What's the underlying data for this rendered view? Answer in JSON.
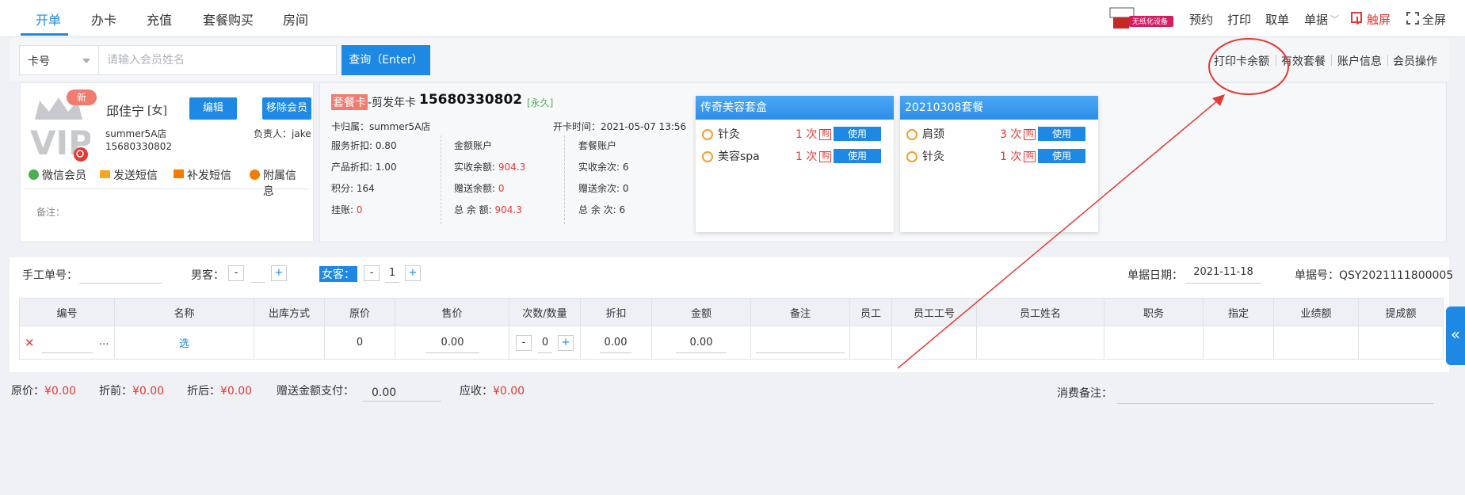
{
  "nav": {
    "tabs": [
      "开单",
      "办卡",
      "充值",
      "套餐购买",
      "房间"
    ],
    "device_badge": "无纸化设备",
    "right": [
      "预约",
      "打印",
      "取单",
      "单据",
      "触屏",
      "全屏"
    ]
  },
  "search": {
    "select_value": "卡号",
    "placeholder": "请输入会员姓名",
    "query_label": "查询（Enter）"
  },
  "account_links": [
    "打印卡余额",
    "有效套餐",
    "账户信息",
    "会员操作"
  ],
  "member": {
    "badge_new": "新",
    "avatar_text": "VIP",
    "name": "邱佳宁",
    "gender": "[女]",
    "store": "summer5A店",
    "phone": "15680330802",
    "edit_label": "编辑",
    "remove_label": "移除会员",
    "owner_label": "负责人：jake",
    "actions": [
      "微信会员",
      "发送短信",
      "补发短信",
      "附属信息"
    ],
    "remark_label": "备注："
  },
  "card": {
    "type_tag": "套餐卡",
    "type_suffix": "-剪发年卡",
    "number": "15680330802",
    "validity": "[永久]",
    "belong": "卡归属：summer5A店",
    "open_time": "开卡时间：2021-05-07 13:56",
    "col1": [
      {
        "label": "服务折扣: 0.80",
        "value": ""
      },
      {
        "label": "产品折扣: 1.00",
        "value": ""
      },
      {
        "label": "积分: 164",
        "value": ""
      },
      {
        "label": "挂账: ",
        "value": "0"
      }
    ],
    "col2_title": "金额账户",
    "col2": [
      {
        "label": "实收余额: ",
        "value": "904.3"
      },
      {
        "label": "赠送余额: ",
        "value": "0"
      },
      {
        "label": "总 余 额: ",
        "value": "904.3"
      }
    ],
    "col3_title": "套餐账户",
    "col3": [
      "实收余次: 6",
      "赠送余次: 0",
      "总 余 次: 6"
    ]
  },
  "packages": [
    {
      "title": "传奇美容套盒",
      "items": [
        {
          "name": "针灸",
          "count": "1 次",
          "buy": "购",
          "use": "使用",
          "icon": "service-icon"
        },
        {
          "name": "美容spa",
          "count": "1 次",
          "buy": "购",
          "use": "使用",
          "icon": "service-icon"
        }
      ]
    },
    {
      "title": "20210308套餐",
      "items": [
        {
          "name": "肩颈",
          "count": "3 次",
          "buy": "购",
          "use": "使用",
          "icon": "service-icon"
        },
        {
          "name": "针灸",
          "count": "1 次",
          "buy": "购",
          "use": "使用",
          "icon": "service-icon"
        }
      ]
    }
  ],
  "order": {
    "manual_no_label": "手工单号：",
    "male_label": "男客：",
    "male_value": "",
    "female_label": "女客：",
    "female_value": "1",
    "date_label": "单据日期：",
    "date_value": "2021-11-18",
    "doc_no_label": "单据号：QSY2021111800005",
    "columns": [
      "编号",
      "名称",
      "出库方式",
      "原价",
      "售价",
      "次数/数量",
      "折扣",
      "金额",
      "备注",
      "员工",
      "员工工号",
      "员工姓名",
      "职务",
      "指定",
      "业绩额",
      "提成额"
    ],
    "row": {
      "delete": "✕",
      "more": "...",
      "name": "选",
      "orig_price": "0",
      "sale_price": "0.00",
      "qty": "0",
      "discount": "0.00",
      "amount": "0.00"
    },
    "minus": "-",
    "plus": "+"
  },
  "footer": {
    "orig_label": "原价：",
    "orig_value": "¥0.00",
    "before_label": "折前：",
    "before_value": "¥0.00",
    "after_label": "折后：",
    "after_value": "¥0.00",
    "gift_label": "赠送金额支付：",
    "gift_value": "0.00",
    "due_label": "应收：",
    "due_value": "¥0.00",
    "remark_label": "消费备注："
  },
  "side_tab": "«",
  "colors": {
    "accent": "#1e88e5",
    "red": "#e53935",
    "annotation": "#e53935"
  }
}
